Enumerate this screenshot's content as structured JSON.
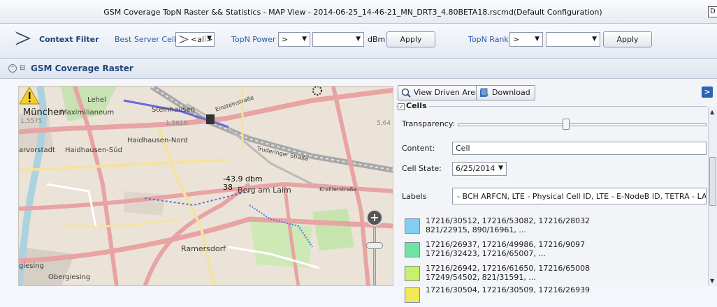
{
  "window": {
    "title": "GSM Coverage TopN Raster && Statistics - MAP View - 2014-06-25_14-46-21_MN_DRT3_4.80BETA18.rscmd(Default Configuration)",
    "button_glyph": "D"
  },
  "filter_bar": {
    "context_filter_label": "Context Filter",
    "best_server_label": "Best Server Cell",
    "best_server_value": "<all>",
    "topn_power_label": "TopN Power",
    "topn_power_operator": ">",
    "topn_power_value": "",
    "topn_power_unit": "dBm",
    "apply_label": "Apply",
    "topn_rank_label": "TopN Rank",
    "topn_rank_operator": ">",
    "topn_rank_value": "",
    "apply2_label": "Apply"
  },
  "section": {
    "title": "GSM Coverage Raster"
  },
  "map": {
    "labels": {
      "city": "München",
      "lehel": "Lehel",
      "maximilianeum": "Maximilianeum",
      "steinhausen": "Steinhausen",
      "haidhausen_nord": "Haidhausen-Nord",
      "haidhausen_sued": "Haidhausen-Süd",
      "au_vorstadt": "arvorstadt",
      "berg_am_laim": "Berg am Laim",
      "ramersdorf": "Ramersdorf",
      "giesing": "giesing",
      "obergiesing": "Obergiesing",
      "coord_left": "1,5575",
      "coord_mid": "1,5616",
      "coord_right": "5,64",
      "trudering": "Truderinger Straße",
      "kreiller": "Kreillerstraße",
      "einstein": "Einsteinstraße"
    },
    "measurement": {
      "value": "-43.9 dbm",
      "rank": "38"
    },
    "zoom_in_glyph": "+"
  },
  "panel": {
    "view_driven_area_label": "View Driven Area",
    "download_label": "Download",
    "expand_glyph": ">",
    "cells": {
      "legend": "Cells",
      "transparency_label": "Transparency:",
      "transparency_level": 0.62,
      "content_label": "Content:",
      "content_value": "Cell",
      "cell_state_label": "Cell State:",
      "cell_state_value": "6/25/2014",
      "labels_label": "Labels",
      "labels_value": "- BCH ARFCN, LTE - Physical Cell ID, LTE - E-NodeB ID, TETRA - LA, TETR"
    },
    "legend_items": [
      {
        "color": "#7ecff2",
        "line1": "17216/30512, 17216/53082, 17216/28032",
        "line2": "821/22915, 890/16961, ..."
      },
      {
        "color": "#6fe3a4",
        "line1": "17216/26937, 17216/49986, 17216/9097",
        "line2": "17216/32423, 17216/65007, ..."
      },
      {
        "color": "#c7f06b",
        "line1": "17216/26942, 17216/61650, 17216/65008",
        "line2": "17249/54502, 821/31591, ..."
      },
      {
        "color": "#f3e857",
        "line1": "17216/30504, 17216/30509, 17216/26939",
        "line2": ""
      }
    ]
  }
}
